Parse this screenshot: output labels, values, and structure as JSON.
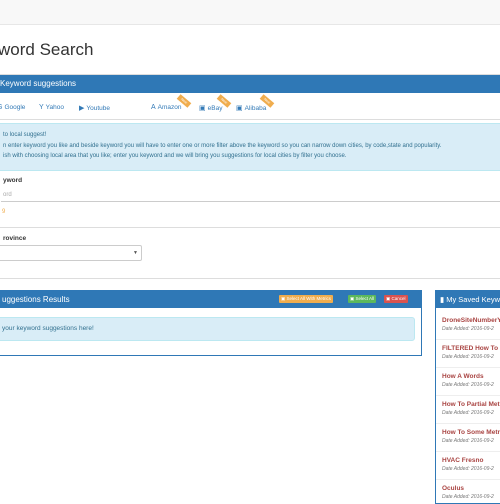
{
  "page": {
    "title": "word Search"
  },
  "panel": {
    "title": "Keyword suggestions"
  },
  "tabs": [
    {
      "label": "Google",
      "icon": "google-icon"
    },
    {
      "label": "Yahoo",
      "icon": "yahoo-icon"
    },
    {
      "label": "Youtube",
      "icon": "youtube-icon"
    },
    {
      "label": "Amazon",
      "icon": "amazon-icon",
      "ribbon": "New"
    },
    {
      "label": "eBay",
      "icon": "ebay-icon",
      "ribbon": "New"
    },
    {
      "label": "Alibaba",
      "icon": "alibaba-icon",
      "ribbon": "New"
    }
  ],
  "info": {
    "line1": "to local suggest!",
    "line2": "n enter keyword you like and beside keyword you will have to enter one or more filter above the keyword so you can narrow down cities, by code,state and popularity.",
    "line3": "ish with choosing local area that you like; enter you keyword and we will bring you suggestions for local cities by filter you choose."
  },
  "keyword": {
    "label": "yword",
    "placeholder": "ord",
    "note": "9"
  },
  "province": {
    "label": "rovince",
    "value": ""
  },
  "results": {
    "title": "uggestions Results",
    "btn_metrics": "Select All With Metrics",
    "btn_select_all": "Select All",
    "btn_cancel": "Cancel",
    "message": "your keyword suggestions here!"
  },
  "saved": {
    "title": "My Saved Keyw",
    "items": [
      {
        "name": "DroneSiteNumberY",
        "date": "Date Added: 2016-09-2"
      },
      {
        "name": "FILTERED How To",
        "date": "Date Added: 2016-09-2"
      },
      {
        "name": "How A Words",
        "date": "Date Added: 2016-09-2"
      },
      {
        "name": "How To Partial Met",
        "date": "Date Added: 2016-09-2"
      },
      {
        "name": "How To Some Metr",
        "date": "Date Added: 2016-09-2"
      },
      {
        "name": "HVAC Fresno",
        "date": "Date Added: 2016-09-2"
      },
      {
        "name": "Oculus",
        "date": "Date Added: 2016-09-2"
      }
    ]
  },
  "colors": {
    "primary": "#2f78b6",
    "info_bg": "#d9edf7",
    "warning": "#f0ad4e",
    "success": "#5cb85c",
    "danger": "#d9534f",
    "link_red": "#a94442"
  }
}
